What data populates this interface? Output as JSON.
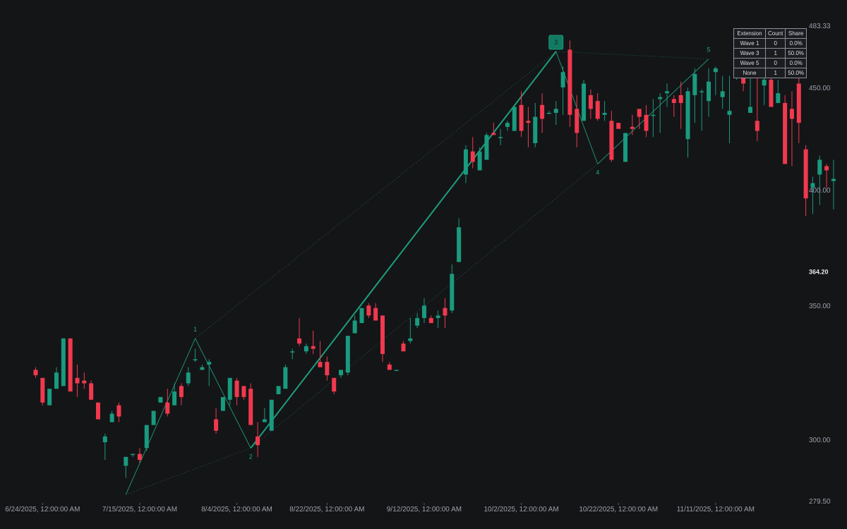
{
  "chart_data": {
    "type": "candlestick",
    "y_scale": "log",
    "ylim": [
      279.5,
      483.33
    ],
    "y_ticks": [
      "483.33",
      "450.00",
      "400.00",
      "350.00",
      "300.00",
      "279.50"
    ],
    "last_price_label": "364.20",
    "x_ticks": [
      {
        "index": 1,
        "label": "6/24/2025, 12:00:00 AM"
      },
      {
        "index": 15,
        "label": "7/15/2025, 12:00:00 AM"
      },
      {
        "index": 29,
        "label": "8/4/2025, 12:00:00 AM"
      },
      {
        "index": 42,
        "label": "8/22/2025, 12:00:00 AM"
      },
      {
        "index": 56,
        "label": "9/12/2025, 12:00:00 AM"
      },
      {
        "index": 70,
        "label": "10/2/2025, 12:00:00 AM"
      },
      {
        "index": 84,
        "label": "10/22/2025, 12:00:00 AM"
      },
      {
        "index": 98,
        "label": "11/11/2025, 12:00:00 AM"
      }
    ],
    "candles": [
      [
        325,
        326,
        322,
        323
      ],
      [
        322,
        322,
        312,
        313
      ],
      [
        312,
        318,
        312,
        318
      ],
      [
        318,
        326,
        318,
        324
      ],
      [
        319,
        337,
        319,
        337
      ],
      [
        337,
        337,
        317,
        317
      ],
      [
        322,
        327,
        315,
        320
      ],
      [
        321,
        324,
        318,
        320
      ],
      [
        320,
        321,
        314,
        314
      ],
      [
        313,
        313,
        307,
        307
      ],
      [
        299,
        302,
        293,
        301
      ],
      [
        306,
        310,
        306,
        309
      ],
      [
        312,
        313,
        306,
        308
      ],
      [
        291,
        294,
        287,
        294
      ],
      [
        295,
        295,
        294,
        295
      ],
      [
        295,
        297,
        292,
        293
      ],
      [
        297,
        305,
        296,
        305
      ],
      [
        305,
        310,
        305,
        310
      ],
      [
        313,
        315,
        313,
        315
      ],
      [
        313,
        318,
        308,
        309
      ],
      [
        312,
        320,
        312,
        317
      ],
      [
        319,
        320,
        312,
        315
      ],
      [
        320,
        326,
        319,
        324
      ],
      [
        329,
        333,
        328,
        329
      ],
      [
        325,
        327,
        325,
        326
      ],
      [
        327,
        329,
        319,
        328
      ],
      [
        307,
        311,
        302,
        303
      ],
      [
        310,
        310,
        310,
        315
      ],
      [
        314,
        322,
        312,
        322
      ],
      [
        321,
        322,
        312,
        315
      ],
      [
        319,
        319,
        314,
        315
      ],
      [
        318,
        320,
        305,
        305
      ],
      [
        301,
        306,
        294,
        298
      ],
      [
        306,
        311,
        306,
        307
      ],
      [
        303,
        314,
        304,
        314
      ],
      [
        316,
        319,
        316,
        319
      ],
      [
        318,
        327,
        318,
        326
      ],
      [
        332,
        333,
        329,
        332
      ],
      [
        337,
        345,
        334,
        335
      ],
      [
        332,
        335,
        331,
        334
      ],
      [
        334,
        340,
        331,
        333
      ],
      [
        328,
        336,
        328,
        326
      ],
      [
        328,
        330,
        321,
        323
      ],
      [
        322,
        322,
        316,
        317
      ],
      [
        323,
        325,
        322,
        325
      ],
      [
        324,
        338,
        323,
        338
      ],
      [
        339,
        346,
        339,
        344
      ],
      [
        343,
        349,
        343,
        349
      ],
      [
        350,
        351,
        345,
        346
      ],
      [
        349,
        351,
        344,
        344
      ],
      [
        346,
        346,
        328,
        331
      ],
      [
        327,
        328,
        325,
        325
      ],
      [
        325,
        325,
        325,
        325
      ],
      [
        335,
        336,
        333,
        332
      ],
      [
        336,
        345,
        335,
        337
      ],
      [
        342,
        347,
        341,
        345
      ],
      [
        345,
        353,
        343,
        350
      ],
      [
        345,
        346,
        343,
        343
      ],
      [
        345,
        348,
        341,
        346
      ],
      [
        349,
        353,
        341,
        346
      ],
      [
        348,
        367,
        347,
        363
      ],
      [
        368,
        387,
        368,
        383
      ],
      [
        407,
        421,
        403,
        419
      ],
      [
        418,
        425,
        410,
        413
      ],
      [
        409,
        420,
        409,
        418
      ],
      [
        414,
        427,
        414,
        426
      ],
      [
        427,
        432,
        427,
        426
      ],
      [
        425,
        429,
        421,
        425
      ],
      [
        430,
        433,
        428,
        432
      ],
      [
        428,
        441,
        428,
        440
      ],
      [
        441,
        448,
        425,
        428
      ],
      [
        433,
        440,
        420,
        432
      ],
      [
        422,
        442,
        420,
        435
      ],
      [
        441,
        447,
        427,
        434
      ],
      [
        437,
        438,
        437,
        437
      ],
      [
        437,
        443,
        431,
        439
      ],
      [
        450,
        461,
        436,
        458
      ],
      [
        470,
        475,
        430,
        436
      ],
      [
        439,
        446,
        420,
        427
      ],
      [
        433,
        454,
        437,
        452
      ],
      [
        446,
        449,
        434,
        439
      ],
      [
        443,
        447,
        433,
        434
      ],
      [
        436,
        443,
        433,
        437
      ],
      [
        433,
        438,
        413,
        414
      ],
      [
        432,
        431,
        430,
        429
      ],
      [
        413,
        424,
        413,
        427
      ],
      [
        430,
        436,
        426,
        429
      ],
      [
        439,
        439,
        429,
        435
      ],
      [
        436,
        441,
        425,
        428
      ],
      [
        436,
        444,
        425,
        436
      ],
      [
        444,
        447,
        427,
        445
      ],
      [
        447,
        452,
        440,
        448
      ],
      [
        444,
        446,
        435,
        442
      ],
      [
        446,
        453,
        429,
        442
      ],
      [
        424,
        450,
        415,
        448
      ],
      [
        446,
        460,
        432,
        457
      ],
      [
        448,
        449,
        428,
        448
      ],
      [
        443,
        460,
        435,
        453
      ],
      [
        458,
        461,
        446,
        460
      ],
      [
        445,
        456,
        439,
        448
      ],
      [
        436,
        456,
        422,
        438
      ],
      [
        460,
        467,
        454,
        466
      ],
      [
        459,
        461,
        448,
        452
      ],
      [
        437,
        462,
        438,
        440
      ],
      [
        433,
        470,
        423,
        428
      ],
      [
        451,
        459,
        441,
        454
      ],
      [
        454,
        464,
        445,
        440
      ],
      [
        442,
        454,
        442,
        447
      ],
      [
        442,
        446,
        412,
        412
      ],
      [
        439,
        448,
        411,
        434
      ],
      [
        452,
        455,
        422,
        432
      ],
      [
        419,
        421,
        388,
        396
      ],
      [
        401,
        406,
        389,
        403
      ],
      [
        407,
        416,
        393,
        414
      ],
      [
        411,
        412,
        401,
        409
      ],
      [
        404,
        414,
        391,
        405
      ]
    ],
    "wave_points": [
      {
        "index": 13,
        "value": 281.5,
        "label": ""
      },
      {
        "index": 23,
        "value": 337,
        "label": "1"
      },
      {
        "index": 31,
        "value": 297,
        "label": "2"
      },
      {
        "index": 75,
        "value": 469,
        "label": "3"
      },
      {
        "index": 81,
        "value": 412,
        "label": "4"
      },
      {
        "index": 97,
        "value": 465,
        "label": "5"
      }
    ],
    "extension_table": {
      "headers": [
        "Extension",
        "Count",
        "Share"
      ],
      "rows": [
        [
          "Wave 1",
          "0",
          "0.0%"
        ],
        [
          "Wave 3",
          "1",
          "50.0%"
        ],
        [
          "Wave 5",
          "0",
          "0.0%"
        ],
        [
          "None",
          "1",
          "50.0%"
        ]
      ]
    },
    "colors": {
      "background": "#141517",
      "up": "#1a9a7e",
      "down": "#f0394e",
      "wave": "#1fa583",
      "text": "#9aa0a8"
    }
  }
}
